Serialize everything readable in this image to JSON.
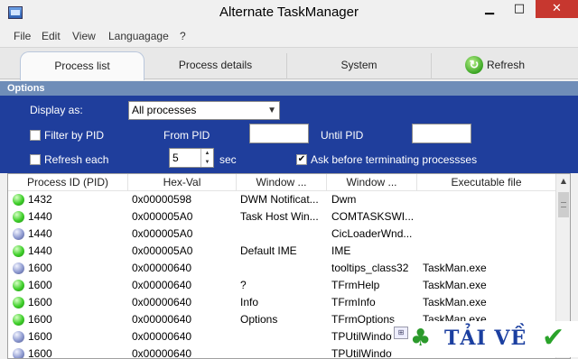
{
  "window": {
    "title": "Alternate TaskManager",
    "min_glyph": "▁",
    "max_glyph": "□",
    "close_glyph": "✕"
  },
  "menu": [
    "File",
    "Edit",
    "View",
    "Languagage",
    "?"
  ],
  "tabs": [
    {
      "label": "Process list"
    },
    {
      "label": "Process details"
    },
    {
      "label": "System"
    },
    {
      "label": "Refresh"
    }
  ],
  "options": {
    "header": "Options",
    "display_as_label": "Display as:",
    "display_as_value": "All processes",
    "filter_by_pid_label": "Filter by PID",
    "filter_by_pid_checked": false,
    "from_pid_label": "From PID",
    "from_pid_value": "",
    "until_pid_label": "Until PID",
    "until_pid_value": "",
    "refresh_each_label": "Refresh each",
    "refresh_each_checked": false,
    "refresh_interval": "5",
    "sec_label": "sec",
    "ask_terminate_label": "Ask before terminating processses",
    "ask_terminate_checked": true
  },
  "table": {
    "columns": [
      "Process ID (PID)",
      "Hex-Val",
      "Window ...",
      "Window ...",
      "Executable file"
    ],
    "rows": [
      {
        "status": "green",
        "pid": "1432",
        "hex": "0x00000598",
        "win1": "DWM Notificat...",
        "win2": "Dwm",
        "exe": ""
      },
      {
        "status": "green",
        "pid": "1440",
        "hex": "0x000005A0",
        "win1": "Task Host Win...",
        "win2": "COMTASKSWI...",
        "exe": ""
      },
      {
        "status": "gray",
        "pid": "1440",
        "hex": "0x000005A0",
        "win1": "",
        "win2": "CicLoaderWnd...",
        "exe": ""
      },
      {
        "status": "green",
        "pid": "1440",
        "hex": "0x000005A0",
        "win1": "Default IME",
        "win2": "IME",
        "exe": ""
      },
      {
        "status": "gray",
        "pid": "1600",
        "hex": "0x00000640",
        "win1": "",
        "win2": "tooltips_class32",
        "exe": "TaskMan.exe"
      },
      {
        "status": "green",
        "pid": "1600",
        "hex": "0x00000640",
        "win1": "?",
        "win2": "TFrmHelp",
        "exe": "TaskMan.exe"
      },
      {
        "status": "green",
        "pid": "1600",
        "hex": "0x00000640",
        "win1": "Info",
        "win2": "TFrmInfo",
        "exe": "TaskMan.exe"
      },
      {
        "status": "green",
        "pid": "1600",
        "hex": "0x00000640",
        "win1": "Options",
        "win2": "TFrmOptions",
        "exe": "TaskMan.exe"
      },
      {
        "status": "gray",
        "pid": "1600",
        "hex": "0x00000640",
        "win1": "",
        "win2": "TPUtilWindow",
        "exe": ""
      },
      {
        "status": "gray",
        "pid": "1600",
        "hex": "0x00000640",
        "win1": "",
        "win2": "TPUtilWindow",
        "exe": ""
      }
    ]
  },
  "watermark": {
    "text": "TẢI VỀ",
    "clover": "♣",
    "check": "✔",
    "mini": "⊞"
  },
  "colors": {
    "options_bg": "#1f3e9c",
    "options_header_bg": "#6f8db8",
    "close_btn": "#c7372f"
  }
}
